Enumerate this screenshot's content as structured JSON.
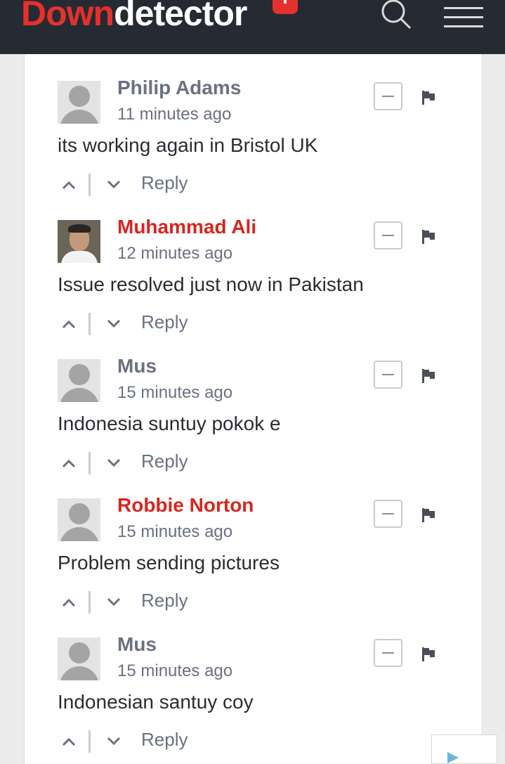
{
  "header": {
    "logo_part1": "Down",
    "logo_part2": "detector",
    "icons": [
      "search-icon",
      "menu-icon"
    ]
  },
  "colors": {
    "header_bg": "#262a33",
    "brand_red": "#e5312b",
    "muted_text": "#6a7181",
    "body_text": "#2b2d33"
  },
  "comments": [
    {
      "name": "Philip Adams",
      "time": "11 minutes ago",
      "text": "its working again in Bristol UK",
      "reply": "Reply",
      "name_highlight": false,
      "avatar": "placeholder"
    },
    {
      "name": "Muhammad Ali",
      "time": "12 minutes ago",
      "text": "Issue resolved just now in Pakistan",
      "reply": "Reply",
      "name_highlight": true,
      "avatar": "photo"
    },
    {
      "name": "Mus",
      "time": "15 minutes ago",
      "text": "Indonesia suntuy pokok e",
      "reply": "Reply",
      "name_highlight": false,
      "avatar": "placeholder"
    },
    {
      "name": "Robbie Norton",
      "time": "15 minutes ago",
      "text": "Problem sending pictures",
      "reply": "Reply",
      "name_highlight": true,
      "avatar": "placeholder"
    },
    {
      "name": "Mus",
      "time": "15 minutes ago",
      "text": "Indonesian santuy coy",
      "reply": "Reply",
      "name_highlight": false,
      "avatar": "placeholder"
    }
  ]
}
